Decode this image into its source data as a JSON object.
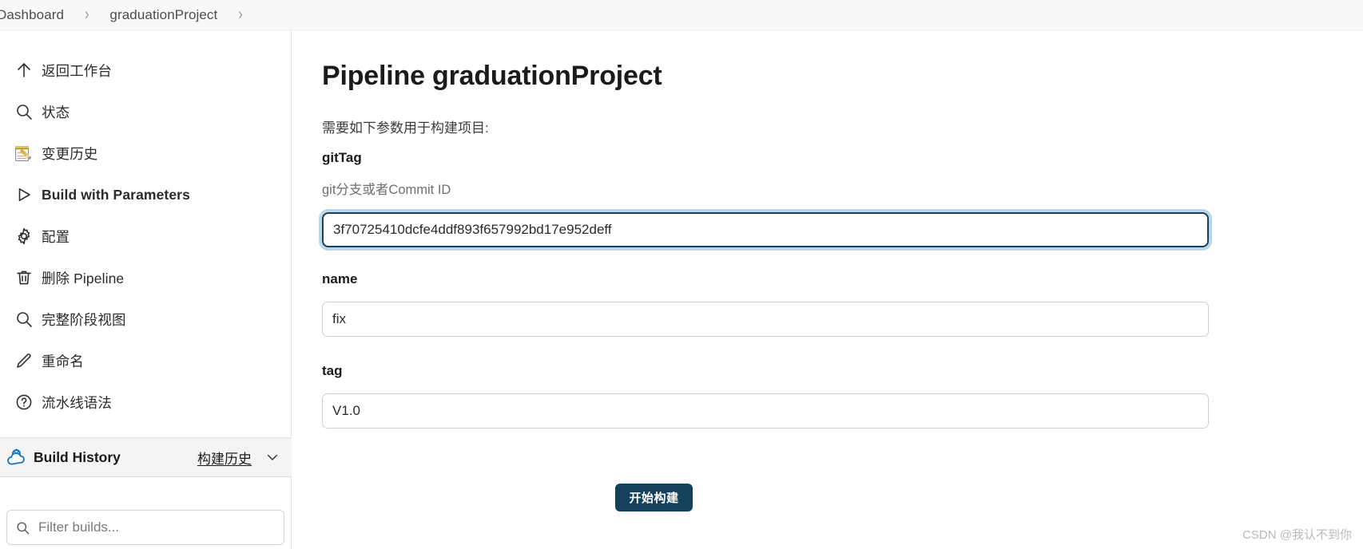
{
  "breadcrumb": {
    "items": [
      {
        "label": "Dashboard"
      },
      {
        "label": "graduationProject"
      }
    ],
    "separator": "›"
  },
  "sidebar": {
    "items": [
      {
        "label": "返回工作台",
        "icon": "arrow-up-icon",
        "bold": false
      },
      {
        "label": "状态",
        "icon": "search-icon",
        "bold": false
      },
      {
        "label": "变更历史",
        "icon": "notepad-pencil-icon",
        "bold": false
      },
      {
        "label": "Build with Parameters",
        "icon": "play-triangle-icon",
        "bold": true
      },
      {
        "label": "配置",
        "icon": "gear-icon",
        "bold": false
      },
      {
        "label": "删除 Pipeline",
        "icon": "trash-icon",
        "bold": false
      },
      {
        "label": "完整阶段视图",
        "icon": "search-icon",
        "bold": false
      },
      {
        "label": "重命名",
        "icon": "pencil-icon",
        "bold": false
      },
      {
        "label": "流水线语法",
        "icon": "question-circle-icon",
        "bold": false
      }
    ],
    "build_history": {
      "title": "Build History",
      "link_label": "构建历史",
      "icon": "weather-cloud-icon",
      "chevron": "chevron-down-icon"
    },
    "filter": {
      "placeholder": "Filter builds...",
      "value": "",
      "icon": "search-icon"
    }
  },
  "main": {
    "title": "Pipeline graduationProject",
    "description": "需要如下参数用于构建项目:",
    "fields": [
      {
        "label": "gitTag",
        "help": "git分支或者Commit ID",
        "value": "3f70725410dcfe4ddf893f657992bd17e952deff",
        "placeholder": "",
        "focused": true
      },
      {
        "label": "name",
        "help": "",
        "value": "fix",
        "placeholder": "",
        "focused": false
      },
      {
        "label": "tag",
        "help": "",
        "value": "V1.0",
        "placeholder": "",
        "focused": false
      }
    ],
    "submit_label": "开始构建"
  },
  "watermark": "CSDN @我认不到你",
  "colors": {
    "accent": "#16415c",
    "focus_ring": "#bcd6e6",
    "border": "#c9d1d8",
    "panel_bg": "#f4f4f4",
    "breadcrumb_bg": "#f8f8f8"
  }
}
